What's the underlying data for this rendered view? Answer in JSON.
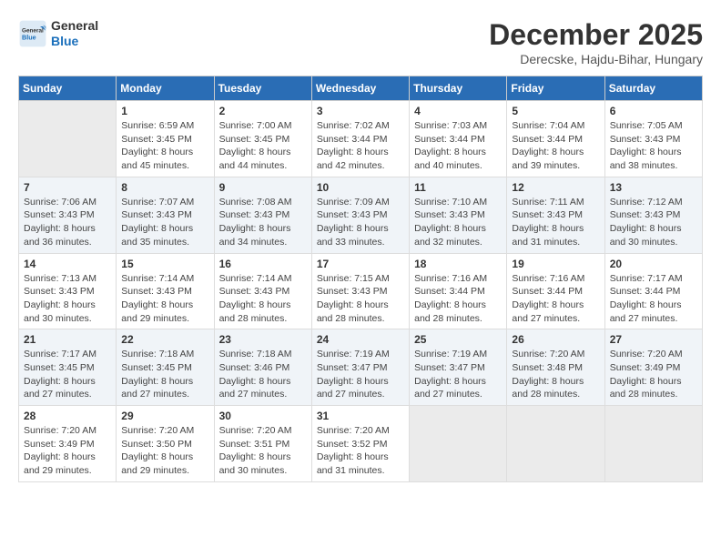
{
  "header": {
    "logo_general": "General",
    "logo_blue": "Blue",
    "month_year": "December 2025",
    "location": "Derecske, Hajdu-Bihar, Hungary"
  },
  "weekdays": [
    "Sunday",
    "Monday",
    "Tuesday",
    "Wednesday",
    "Thursday",
    "Friday",
    "Saturday"
  ],
  "weeks": [
    [
      {
        "day": "",
        "sunrise": "",
        "sunset": "",
        "daylight": ""
      },
      {
        "day": "1",
        "sunrise": "Sunrise: 6:59 AM",
        "sunset": "Sunset: 3:45 PM",
        "daylight": "Daylight: 8 hours and 45 minutes."
      },
      {
        "day": "2",
        "sunrise": "Sunrise: 7:00 AM",
        "sunset": "Sunset: 3:45 PM",
        "daylight": "Daylight: 8 hours and 44 minutes."
      },
      {
        "day": "3",
        "sunrise": "Sunrise: 7:02 AM",
        "sunset": "Sunset: 3:44 PM",
        "daylight": "Daylight: 8 hours and 42 minutes."
      },
      {
        "day": "4",
        "sunrise": "Sunrise: 7:03 AM",
        "sunset": "Sunset: 3:44 PM",
        "daylight": "Daylight: 8 hours and 40 minutes."
      },
      {
        "day": "5",
        "sunrise": "Sunrise: 7:04 AM",
        "sunset": "Sunset: 3:44 PM",
        "daylight": "Daylight: 8 hours and 39 minutes."
      },
      {
        "day": "6",
        "sunrise": "Sunrise: 7:05 AM",
        "sunset": "Sunset: 3:43 PM",
        "daylight": "Daylight: 8 hours and 38 minutes."
      }
    ],
    [
      {
        "day": "7",
        "sunrise": "Sunrise: 7:06 AM",
        "sunset": "Sunset: 3:43 PM",
        "daylight": "Daylight: 8 hours and 36 minutes."
      },
      {
        "day": "8",
        "sunrise": "Sunrise: 7:07 AM",
        "sunset": "Sunset: 3:43 PM",
        "daylight": "Daylight: 8 hours and 35 minutes."
      },
      {
        "day": "9",
        "sunrise": "Sunrise: 7:08 AM",
        "sunset": "Sunset: 3:43 PM",
        "daylight": "Daylight: 8 hours and 34 minutes."
      },
      {
        "day": "10",
        "sunrise": "Sunrise: 7:09 AM",
        "sunset": "Sunset: 3:43 PM",
        "daylight": "Daylight: 8 hours and 33 minutes."
      },
      {
        "day": "11",
        "sunrise": "Sunrise: 7:10 AM",
        "sunset": "Sunset: 3:43 PM",
        "daylight": "Daylight: 8 hours and 32 minutes."
      },
      {
        "day": "12",
        "sunrise": "Sunrise: 7:11 AM",
        "sunset": "Sunset: 3:43 PM",
        "daylight": "Daylight: 8 hours and 31 minutes."
      },
      {
        "day": "13",
        "sunrise": "Sunrise: 7:12 AM",
        "sunset": "Sunset: 3:43 PM",
        "daylight": "Daylight: 8 hours and 30 minutes."
      }
    ],
    [
      {
        "day": "14",
        "sunrise": "Sunrise: 7:13 AM",
        "sunset": "Sunset: 3:43 PM",
        "daylight": "Daylight: 8 hours and 30 minutes."
      },
      {
        "day": "15",
        "sunrise": "Sunrise: 7:14 AM",
        "sunset": "Sunset: 3:43 PM",
        "daylight": "Daylight: 8 hours and 29 minutes."
      },
      {
        "day": "16",
        "sunrise": "Sunrise: 7:14 AM",
        "sunset": "Sunset: 3:43 PM",
        "daylight": "Daylight: 8 hours and 28 minutes."
      },
      {
        "day": "17",
        "sunrise": "Sunrise: 7:15 AM",
        "sunset": "Sunset: 3:43 PM",
        "daylight": "Daylight: 8 hours and 28 minutes."
      },
      {
        "day": "18",
        "sunrise": "Sunrise: 7:16 AM",
        "sunset": "Sunset: 3:44 PM",
        "daylight": "Daylight: 8 hours and 28 minutes."
      },
      {
        "day": "19",
        "sunrise": "Sunrise: 7:16 AM",
        "sunset": "Sunset: 3:44 PM",
        "daylight": "Daylight: 8 hours and 27 minutes."
      },
      {
        "day": "20",
        "sunrise": "Sunrise: 7:17 AM",
        "sunset": "Sunset: 3:44 PM",
        "daylight": "Daylight: 8 hours and 27 minutes."
      }
    ],
    [
      {
        "day": "21",
        "sunrise": "Sunrise: 7:17 AM",
        "sunset": "Sunset: 3:45 PM",
        "daylight": "Daylight: 8 hours and 27 minutes."
      },
      {
        "day": "22",
        "sunrise": "Sunrise: 7:18 AM",
        "sunset": "Sunset: 3:45 PM",
        "daylight": "Daylight: 8 hours and 27 minutes."
      },
      {
        "day": "23",
        "sunrise": "Sunrise: 7:18 AM",
        "sunset": "Sunset: 3:46 PM",
        "daylight": "Daylight: 8 hours and 27 minutes."
      },
      {
        "day": "24",
        "sunrise": "Sunrise: 7:19 AM",
        "sunset": "Sunset: 3:47 PM",
        "daylight": "Daylight: 8 hours and 27 minutes."
      },
      {
        "day": "25",
        "sunrise": "Sunrise: 7:19 AM",
        "sunset": "Sunset: 3:47 PM",
        "daylight": "Daylight: 8 hours and 27 minutes."
      },
      {
        "day": "26",
        "sunrise": "Sunrise: 7:20 AM",
        "sunset": "Sunset: 3:48 PM",
        "daylight": "Daylight: 8 hours and 28 minutes."
      },
      {
        "day": "27",
        "sunrise": "Sunrise: 7:20 AM",
        "sunset": "Sunset: 3:49 PM",
        "daylight": "Daylight: 8 hours and 28 minutes."
      }
    ],
    [
      {
        "day": "28",
        "sunrise": "Sunrise: 7:20 AM",
        "sunset": "Sunset: 3:49 PM",
        "daylight": "Daylight: 8 hours and 29 minutes."
      },
      {
        "day": "29",
        "sunrise": "Sunrise: 7:20 AM",
        "sunset": "Sunset: 3:50 PM",
        "daylight": "Daylight: 8 hours and 29 minutes."
      },
      {
        "day": "30",
        "sunrise": "Sunrise: 7:20 AM",
        "sunset": "Sunset: 3:51 PM",
        "daylight": "Daylight: 8 hours and 30 minutes."
      },
      {
        "day": "31",
        "sunrise": "Sunrise: 7:20 AM",
        "sunset": "Sunset: 3:52 PM",
        "daylight": "Daylight: 8 hours and 31 minutes."
      },
      {
        "day": "",
        "sunrise": "",
        "sunset": "",
        "daylight": ""
      },
      {
        "day": "",
        "sunrise": "",
        "sunset": "",
        "daylight": ""
      },
      {
        "day": "",
        "sunrise": "",
        "sunset": "",
        "daylight": ""
      }
    ]
  ]
}
